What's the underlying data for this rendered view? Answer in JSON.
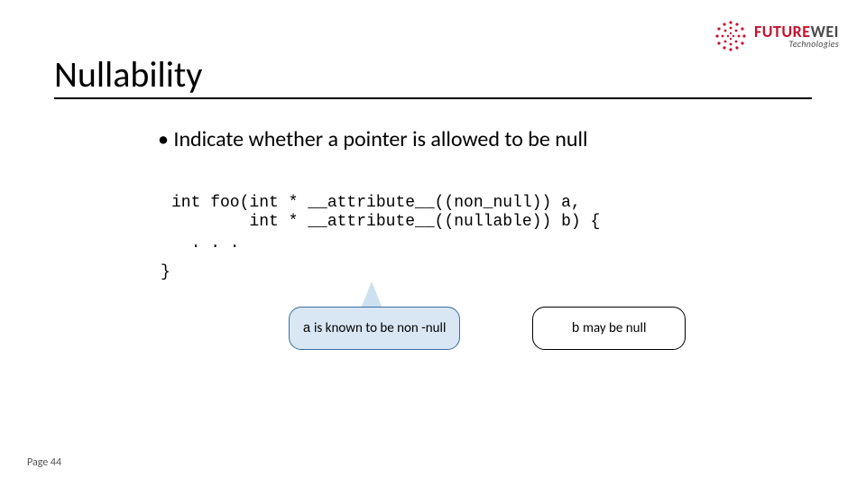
{
  "logo": {
    "brand_first": "FUTURE",
    "brand_second": "WEI",
    "sub": "Technologies"
  },
  "title": "Nullability",
  "bullet": "Indicate whether a pointer is allowed to be null",
  "code": {
    "line1": "int foo(int * __attribute__((non_null)) a,",
    "line2": "        int * __attribute__((nullable)) b) {",
    "line3": "  . . .",
    "line4": "}"
  },
  "callouts": {
    "a_var": "a",
    "a_rest": " is known to be non -null",
    "b_var": "b",
    "b_rest": " may be null"
  },
  "page": "Page 44"
}
